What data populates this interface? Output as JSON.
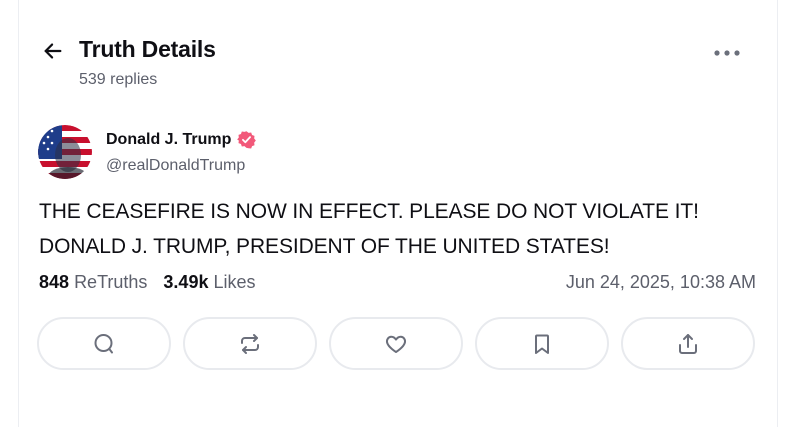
{
  "header": {
    "title": "Truth Details",
    "replies": "539 replies"
  },
  "author": {
    "name": "Donald J. Trump",
    "handle": "@realDonaldTrump",
    "verified": true,
    "verified_color": "#f2597a"
  },
  "post": {
    "lines": [
      "THE CEASEFIRE IS NOW IN EFFECT. PLEASE DO NOT VIOLATE IT!",
      "DONALD J. TRUMP, PRESIDENT OF THE UNITED STATES!"
    ]
  },
  "stats": {
    "retruths_count": "848",
    "retruths_label": "ReTruths",
    "likes_count": "3.49k",
    "likes_label": "Likes",
    "timestamp": "Jun 24, 2025, 10:38 AM"
  },
  "actions": [
    {
      "icon": "reply-icon"
    },
    {
      "icon": "retruth-icon"
    },
    {
      "icon": "heart-icon"
    },
    {
      "icon": "bookmark-icon"
    },
    {
      "icon": "share-icon"
    }
  ],
  "colors": {
    "text": "#0f0f14",
    "muted": "#5c5f6b",
    "border": "#e8eaee",
    "icon": "#6b6f7b"
  }
}
